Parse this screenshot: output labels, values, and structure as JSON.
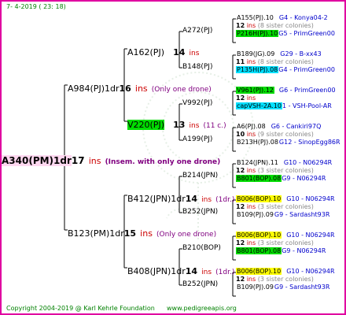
{
  "header": {
    "date": "7-  4-2019 ( 23: 18)"
  },
  "footer": {
    "copyright": "Copyright 2004-2019 @ Karl Kehrle Foundation",
    "site": "www.pedigreeapis.org"
  },
  "colors": {
    "border": "#e000a0",
    "green_box": "#00dd00",
    "cyan_box": "#00e0ff",
    "yellow_box": "#ffff00"
  },
  "root": {
    "name": "A340(PM)1dr",
    "num": "17",
    "ins": "ins",
    "note": "(Insem. with only one drone)"
  },
  "gen1": [
    {
      "name": "A984(PJ)1dr",
      "num": "16",
      "ins": "ins",
      "note": "(Only one drone)"
    },
    {
      "name": "B123(PM)1dr",
      "num": "15",
      "ins": "ins",
      "note": "(Only one drone)"
    }
  ],
  "gen2": [
    {
      "name": "A162(PJ)",
      "num": "14",
      "ins": "ins",
      "note": ""
    },
    {
      "name": "V220(PJ)",
      "num": "13",
      "ins": "ins",
      "note": "(11 c.)"
    },
    {
      "name": "B412(JPN)1dr",
      "num": "14",
      "ins": "ins",
      "note": "(1dr.)"
    },
    {
      "name": "B408(JPN)1dr",
      "num": "14",
      "ins": "ins",
      "note": "(1dr.)"
    }
  ],
  "gen3": [
    {
      "name": "A272(PJ)"
    },
    {
      "name": "B148(PJ)"
    },
    {
      "name": "V992(PJ)"
    },
    {
      "name": "A199(PJ)"
    },
    {
      "name": "B214(JPN)"
    },
    {
      "name": "B252(JPN)"
    },
    {
      "name": "B210(BOP)"
    },
    {
      "name": "B252(JPN)"
    }
  ],
  "gen4": [
    {
      "top": "A155(PJ).10",
      "top_right": "G4 - Konya04-2",
      "mid_num": "12",
      "mid_ins": "ins",
      "mid_note": "(8 sister colonies)",
      "bot": "P216H(PJ).10",
      "bot_right": "G5 - PrimGreen00",
      "bot_bg": "green"
    },
    {
      "top": "B189(JG).09",
      "top_right": "G29 - B-xx43",
      "mid_num": "11",
      "mid_ins": "ins",
      "mid_note": "(8 sister colonies)",
      "bot": "P135H(PJ).08",
      "bot_right": "G4 - PrimGreen00",
      "bot_bg": "cyan"
    },
    {
      "top": "V961(PJ).12",
      "top_right": "G6 - PrimGreen00",
      "top_bg": "green",
      "mid_num": "12",
      "mid_ins": "ins",
      "mid_note": "",
      "bot": "capVSH-2A.10",
      "bot_right": "1 - VSH-Pool-AR",
      "bot_bg": "cyan"
    },
    {
      "top": "A6(PJ).08",
      "top_right": "G6 - Cankiri97Q",
      "mid_num": "10",
      "mid_ins": "ins",
      "mid_note": "(9 sister colonies)",
      "bot": "B213H(PJ).08",
      "bot_right": "G12 - SinopEgg86R"
    },
    {
      "top": "B124(JPN).11",
      "top_right": "G10 - N06294R",
      "mid_num": "12",
      "mid_ins": "ins",
      "mid_note": "(3 sister colonies)",
      "bot": "B801(BOP).08",
      "bot_right": "G9 - N06294R",
      "bot_bg": "green"
    },
    {
      "top": "B006(BOP).10",
      "top_right": "G10 - N06294R",
      "top_bg": "yellow",
      "mid_num": "12",
      "mid_ins": "ins",
      "mid_note": "(3 sister colonies)",
      "bot": "B109(PJ).09",
      "bot_right": "G9 - Sardasht93R"
    },
    {
      "top": "B006(BOP).10",
      "top_right": "G10 - N06294R",
      "top_bg": "yellow",
      "mid_num": "12",
      "mid_ins": "ins",
      "mid_note": "(3 sister colonies)",
      "bot": "B801(BOP).08",
      "bot_right": "G9 - N06294R",
      "bot_bg": "green"
    },
    {
      "top": "B006(BOP).10",
      "top_right": "G10 - N06294R",
      "top_bg": "yellow",
      "mid_num": "12",
      "mid_ins": "ins",
      "mid_note": "(3 sister colonies)",
      "bot": "B109(PJ).09",
      "bot_right": "G9 - Sardasht93R"
    }
  ]
}
